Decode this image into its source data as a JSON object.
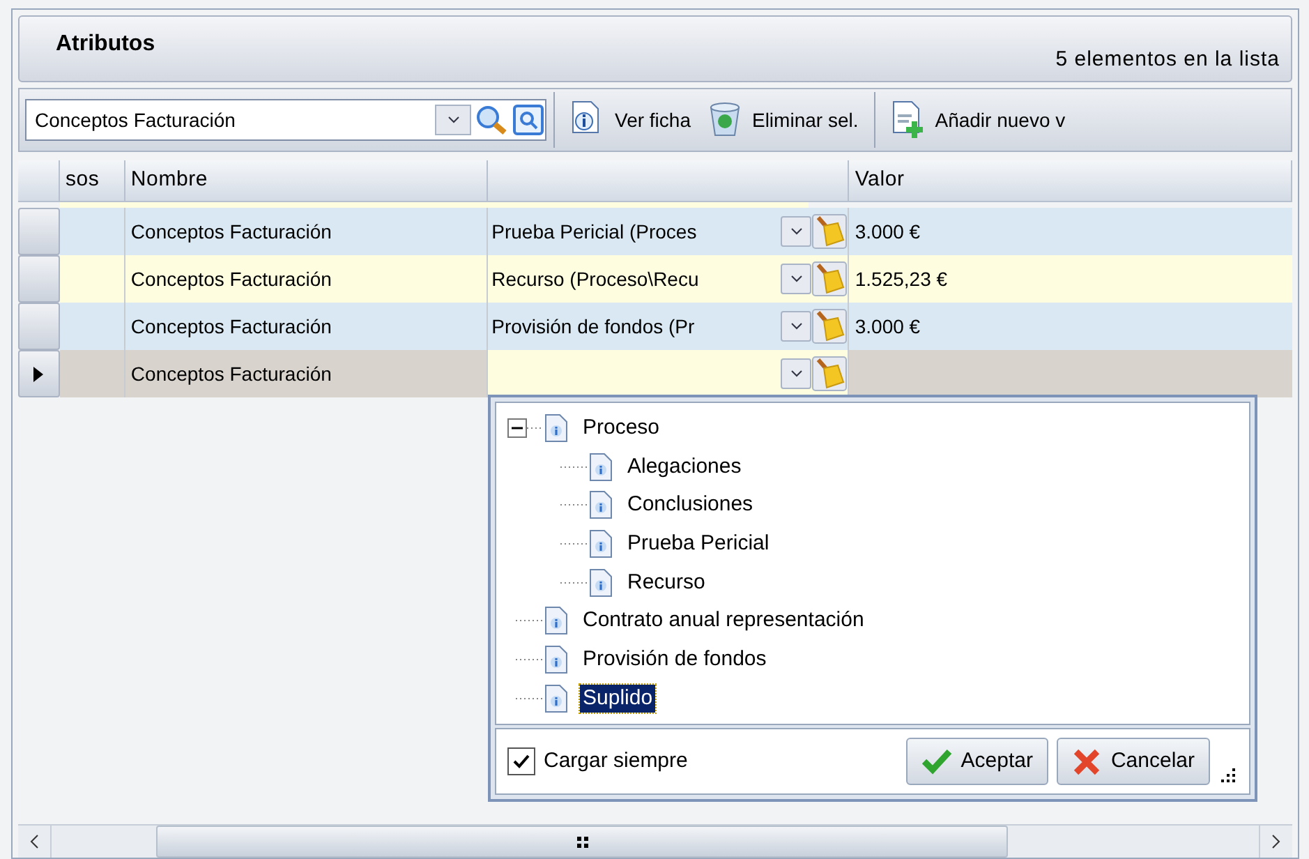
{
  "panel": {
    "title": "Atributos",
    "count": "5 elementos en la lista"
  },
  "toolbar": {
    "filter_value": "Conceptos Facturación",
    "buttons": [
      {
        "kind": "info",
        "label": "Ver ficha"
      },
      {
        "kind": "trash",
        "label": "Eliminar sel."
      },
      {
        "kind": "add",
        "label": "Añadir nuevo v"
      }
    ]
  },
  "table": {
    "columns": [
      "sos",
      "Nombre",
      "",
      "Valor"
    ],
    "rows": [
      {
        "nombre": "Conceptos Facturación",
        "concepto": "Prueba Pericial (Proces",
        "valor": "3.000 €",
        "selected": false
      },
      {
        "nombre": "Conceptos Facturación",
        "concepto": "Recurso (Proceso\\Recu",
        "valor": "1.525,23 €",
        "selected": false
      },
      {
        "nombre": "Conceptos Facturación",
        "concepto": "Provisión de fondos (Pr",
        "valor": "3.000 €",
        "selected": false
      },
      {
        "nombre": "Conceptos Facturación",
        "concepto": "",
        "valor": "",
        "selected": true
      }
    ]
  },
  "dropdown": {
    "tree": [
      {
        "label": "Proceso",
        "expanded": true,
        "selected": false,
        "children": [
          {
            "label": "Alegaciones",
            "selected": false
          },
          {
            "label": "Conclusiones",
            "selected": false
          },
          {
            "label": "Prueba Pericial",
            "selected": false
          },
          {
            "label": "Recurso",
            "selected": false
          }
        ]
      },
      {
        "label": "Contrato anual representación",
        "selected": false
      },
      {
        "label": "Provisión de fondos",
        "selected": false
      },
      {
        "label": "Suplido",
        "selected": true
      }
    ],
    "always_load": {
      "label": "Cargar siempre",
      "checked": true
    },
    "buttons": [
      {
        "kind": "ok",
        "label": "Aceptar"
      },
      {
        "kind": "cancel",
        "label": "Cancelar"
      }
    ]
  }
}
